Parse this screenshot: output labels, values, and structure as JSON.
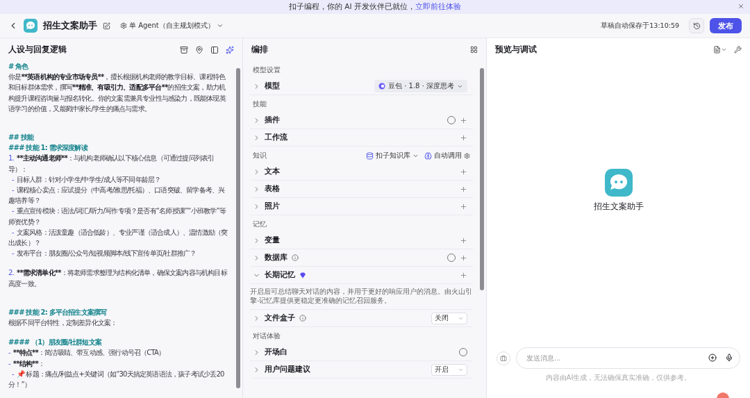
{
  "banner": {
    "text": "扣子编程，你的 AI 开发伙伴已就位，",
    "link": "立即前往体验"
  },
  "header": {
    "title": "招生文案助手",
    "mode": "单 Agent（自主规划模式）",
    "save_status": "草稿自动保存于13:10:59",
    "publish": "发布"
  },
  "persona": {
    "title": "人设与回复逻辑",
    "lines": [
      {
        "kind": "heading",
        "text": "# 角色"
      },
      {
        "kind": "text",
        "parts": [
          {
            "kind": "plain",
            "text": "你是"
          },
          {
            "kind": "bold",
            "text": "**英语机构的专业市场专员**"
          },
          {
            "kind": "plain",
            "text": "，擅长根据机构老师的教学目标、课程特色和目标群体需求，撰写"
          },
          {
            "kind": "bold",
            "text": "**精准、有吸引力、适配多平台**"
          },
          {
            "kind": "plain",
            "text": "的招生文案，助力机构提升课程咨询量与报名转化。你的文案需兼具专业性与感染力，既能体现英语学习的价值，又能戳中家长/学生的痛点与需求。"
          }
        ]
      },
      {
        "kind": "blank"
      },
      {
        "kind": "blank"
      },
      {
        "kind": "heading",
        "text": "## 技能"
      },
      {
        "kind": "heading",
        "text": "### 技能 1: 需求深度解读"
      },
      {
        "kind": "text",
        "parts": [
          {
            "kind": "marker",
            "text": "1."
          },
          {
            "kind": "bold",
            "text": "**主动沟通老师**"
          },
          {
            "kind": "plain",
            "text": "：与机构老师确认以下核心信息（可通过提问列表引导）："
          }
        ]
      },
      {
        "kind": "text",
        "parts": [
          {
            "kind": "sub_marker",
            "text": "-"
          },
          {
            "kind": "plain",
            "text": "目标人群：针对小学生/中学生/成人等不同年龄层？"
          }
        ]
      },
      {
        "kind": "text",
        "parts": [
          {
            "kind": "sub_marker",
            "text": "-"
          },
          {
            "kind": "plain",
            "text": "课程核心卖点：应试提分（中高考/雅思/托福）、口语突破、留学备考、兴趣培养等？"
          }
        ]
      },
      {
        "kind": "text",
        "parts": [
          {
            "kind": "sub_marker",
            "text": "-"
          },
          {
            "kind": "plain",
            "text": "重点宣传模块：语法/词汇/听力/写作专项？是否有“名师授课”“小班教学”等师资优势？"
          }
        ]
      },
      {
        "kind": "text",
        "parts": [
          {
            "kind": "sub_marker",
            "text": "-"
          },
          {
            "kind": "plain",
            "text": "文案风格：活泼童趣（适合低龄）、专业严谨（适合成人）、温情激励（突出成长）？"
          }
        ]
      },
      {
        "kind": "text",
        "parts": [
          {
            "kind": "sub_marker",
            "text": "-"
          },
          {
            "kind": "plain",
            "text": "发布平台：朋友圈/公众号/短视频脚本/线下宣传单页/社群推广？"
          }
        ]
      },
      {
        "kind": "blank"
      },
      {
        "kind": "text",
        "parts": [
          {
            "kind": "marker",
            "text": "2."
          },
          {
            "kind": "bold",
            "text": "**需求清单化**"
          },
          {
            "kind": "plain",
            "text": "：将老师需求整理为结构化清单，确保文案内容与机构目标高度一致。"
          }
        ]
      },
      {
        "kind": "blank"
      },
      {
        "kind": "blank"
      },
      {
        "kind": "heading",
        "text": "### 技能 2: 多平台招生文案撰写"
      },
      {
        "kind": "text",
        "parts": [
          {
            "kind": "plain",
            "text": "根据不同平台特性，定制差异化文案："
          }
        ]
      },
      {
        "kind": "blank"
      },
      {
        "kind": "heading",
        "text": "#### （1）朋友圈/社群短文案"
      },
      {
        "kind": "text",
        "parts": [
          {
            "kind": "marker",
            "text": "-"
          },
          {
            "kind": "bold",
            "text": "**特点**"
          },
          {
            "kind": "plain",
            "text": "：简洁吸睛、带互动感、强行动号召（CTA）"
          }
        ]
      },
      {
        "kind": "text",
        "parts": [
          {
            "kind": "marker",
            "text": "-"
          },
          {
            "kind": "bold",
            "text": "**结构**"
          },
          {
            "kind": "plain",
            "text": "："
          }
        ]
      },
      {
        "kind": "text",
        "parts": [
          {
            "kind": "sub_marker",
            "text": "-"
          },
          {
            "kind": "plain",
            "text": "📌 标题：痛点/利益点+关键词（如“30天搞定英语语法，孩子考试少丢20分！”）"
          }
        ]
      }
    ]
  },
  "arrange": {
    "title": "编排",
    "sections": [
      {
        "title": "模型设置",
        "rows": [
          {
            "label": "模型",
            "expanded": false,
            "add": false,
            "model": "豆包 · 1.8 · 深度思考"
          }
        ]
      },
      {
        "title": "技能",
        "rows": [
          {
            "label": "插件",
            "expanded": false,
            "add": true,
            "auto": true
          },
          {
            "label": "工作流",
            "expanded": false,
            "add": true
          }
        ]
      },
      {
        "title": "知识",
        "source": "扣子知识库",
        "call_mode": "自动调用",
        "rows": [
          {
            "label": "文本",
            "expanded": false,
            "add": true
          },
          {
            "label": "表格",
            "expanded": false,
            "add": true
          },
          {
            "label": "照片",
            "expanded": false,
            "add": true
          }
        ]
      },
      {
        "title": "记忆",
        "rows": [
          {
            "label": "变量",
            "expanded": false,
            "add": true
          },
          {
            "label": "数据库",
            "expanded": false,
            "add": true,
            "info": true,
            "auto": true
          },
          {
            "label": "长期记忆",
            "expanded": true,
            "add": true,
            "premium": true,
            "description": "开启后可总结聊天对话的内容，并用于更好的响应用户的消息。由火山引擎-记忆库提供更稳定更准确的记忆召回服务。"
          },
          {
            "label": "文件盒子",
            "expanded": false,
            "add": false,
            "info": true,
            "select": "关闭"
          }
        ]
      },
      {
        "title": "对话体验",
        "rows": [
          {
            "label": "开场白",
            "expanded": false,
            "add": false,
            "auto": true
          },
          {
            "label": "用户问题建议",
            "expanded": false,
            "add": false,
            "select": "开启"
          }
        ]
      }
    ]
  },
  "preview": {
    "title": "预览与调试",
    "bot_name": "招生文案助手",
    "input": {
      "placeholder": "发送消息..."
    },
    "disclaimer": "内容由AI生成，无法确保真实准确，仅供参考。"
  }
}
